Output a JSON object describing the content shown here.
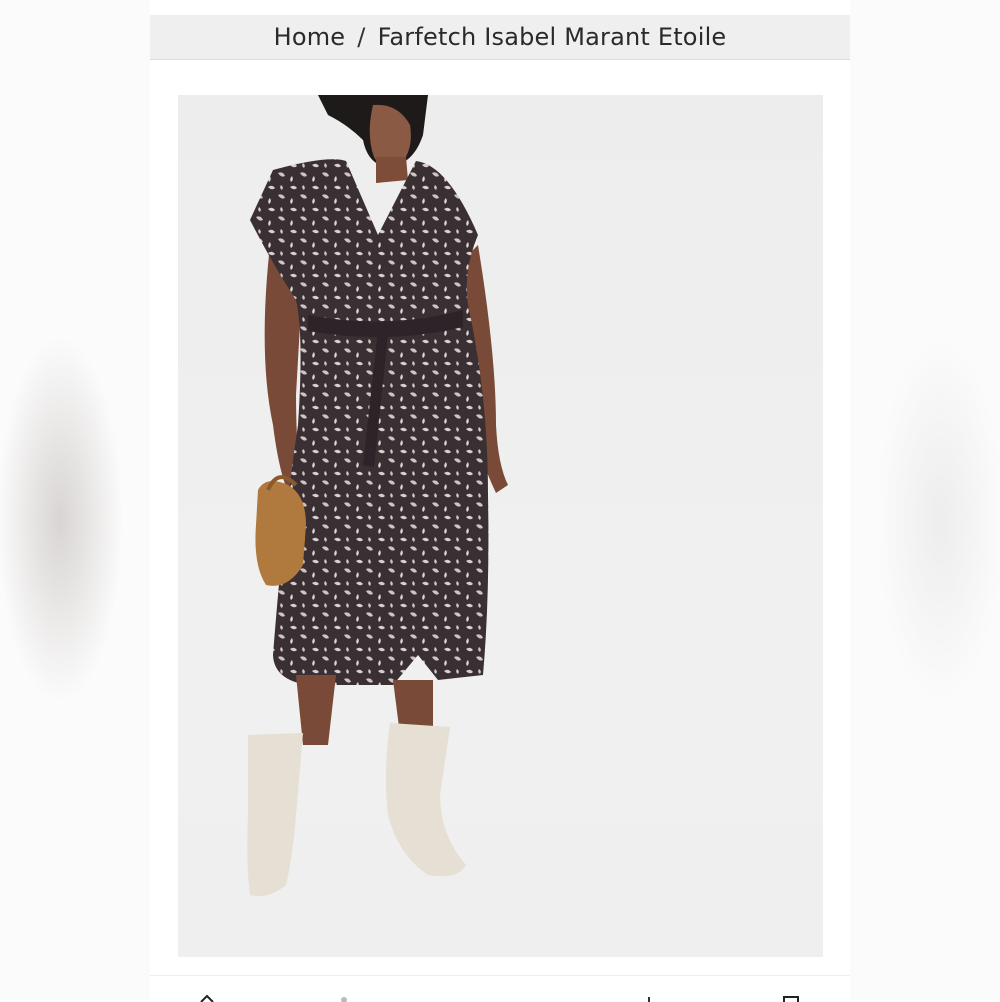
{
  "breadcrumb": {
    "home": "Home",
    "separator": "/",
    "current": "Farfetch Isabel Marant Etoile"
  },
  "product_photo": {
    "icon": "product-image"
  },
  "bottom_toolbar": {
    "icons": [
      "up-arrow-icon",
      "person-icon",
      "share-icon",
      "bookmark-icon"
    ]
  }
}
